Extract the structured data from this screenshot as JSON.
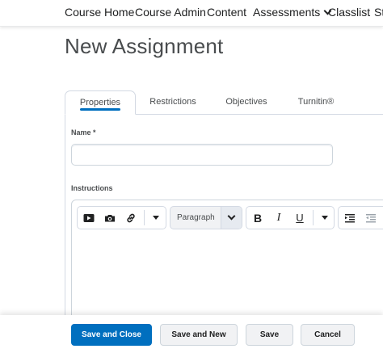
{
  "nav": {
    "items": [
      {
        "label": "Course Home"
      },
      {
        "label": "Course Admin"
      },
      {
        "label": "Content"
      },
      {
        "label": "Assessments"
      },
      {
        "label": "Classlist"
      },
      {
        "label": "St"
      }
    ]
  },
  "page": {
    "title": "New Assignment"
  },
  "tabs": [
    {
      "label": "Properties",
      "active": true
    },
    {
      "label": "Restrictions"
    },
    {
      "label": "Objectives"
    },
    {
      "label": "Turnitin®"
    }
  ],
  "form": {
    "name_label": "Name *",
    "name_value": "",
    "instructions_label": "Instructions"
  },
  "editor": {
    "toolbar": {
      "insert_icons": [
        "video-icon",
        "camera-icon",
        "link-icon"
      ],
      "paragraph_value": "Paragraph",
      "bold_label": "B",
      "italic_label": "I",
      "underline_label": "U",
      "list_icons": [
        "indent-icon",
        "outdent-icon"
      ]
    }
  },
  "actions": {
    "save_close": "Save and Close",
    "save_new": "Save and New",
    "save": "Save",
    "cancel": "Cancel"
  },
  "colors": {
    "accent": "#006fbf",
    "text": "#202122",
    "border": "#cdd5dc"
  }
}
